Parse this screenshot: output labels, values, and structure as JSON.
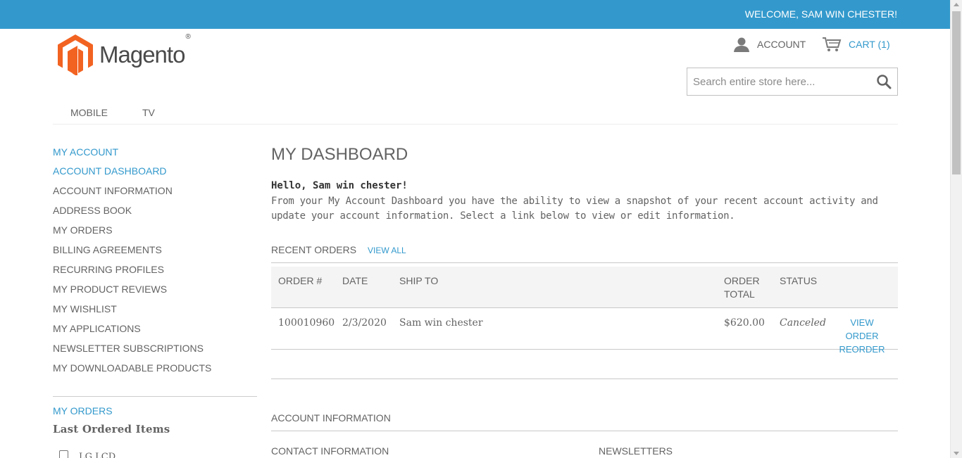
{
  "header": {
    "welcome": "WELCOME, SAM WIN CHESTER!",
    "logo_text": "Magento",
    "logo_mark": "®",
    "account_label": "ACCOUNT",
    "cart_label": "CART (1)",
    "search_placeholder": "Search entire store here...",
    "colors": {
      "topbar": "#3399cc",
      "logo": "#f26322",
      "link": "#3399cc"
    }
  },
  "nav": {
    "items": [
      {
        "label": "MOBILE"
      },
      {
        "label": "TV"
      }
    ]
  },
  "sidebar": {
    "title": "MY ACCOUNT",
    "items": [
      {
        "label": "ACCOUNT DASHBOARD",
        "active": true
      },
      {
        "label": "ACCOUNT INFORMATION"
      },
      {
        "label": "ADDRESS BOOK"
      },
      {
        "label": "MY ORDERS"
      },
      {
        "label": "BILLING AGREEMENTS"
      },
      {
        "label": "RECURRING PROFILES"
      },
      {
        "label": "MY PRODUCT REVIEWS"
      },
      {
        "label": "MY WISHLIST"
      },
      {
        "label": "MY APPLICATIONS"
      },
      {
        "label": "NEWSLETTER SUBSCRIPTIONS"
      },
      {
        "label": "MY DOWNLOADABLE PRODUCTS"
      }
    ],
    "orders_title": "MY ORDERS",
    "last_ordered_title": "Last Ordered Items",
    "last_ordered_items": [
      {
        "name": "LG LCD",
        "checked": false
      }
    ]
  },
  "main": {
    "title": "MY DASHBOARD",
    "hello": "Hello, Sam win chester!",
    "intro": "From your My Account Dashboard you have the ability to view a snapshot of your recent account activity and update your account information. Select a link below to view or edit information.",
    "recent_orders": {
      "title": "RECENT ORDERS",
      "view_all": "VIEW ALL",
      "columns": {
        "order": "ORDER #",
        "date": "DATE",
        "ship_to": "SHIP TO",
        "order_total_line1": "ORDER",
        "order_total_line2": "TOTAL",
        "status": "STATUS"
      },
      "rows": [
        {
          "order": "100010960",
          "date": "2/3/2020",
          "ship_to": "Sam win chester",
          "total": "$620.00",
          "status": "Canceled",
          "view_order": "VIEW ORDER",
          "reorder": "REORDER"
        }
      ]
    },
    "account_information": {
      "title": "ACCOUNT INFORMATION",
      "contact_title": "CONTACT INFORMATION",
      "newsletters_title": "NEWSLETTERS"
    }
  }
}
